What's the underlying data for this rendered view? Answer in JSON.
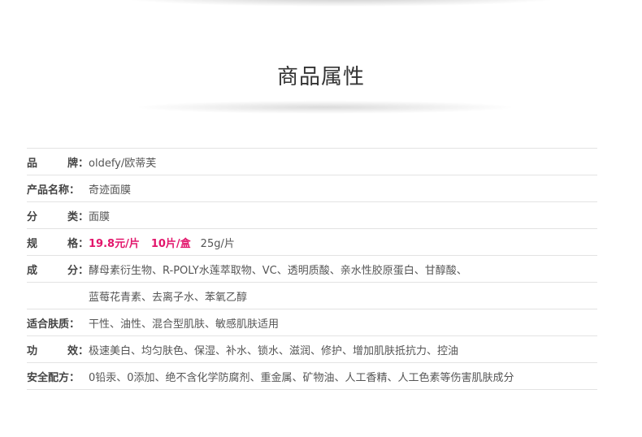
{
  "title": "商品属性",
  "rows": [
    {
      "label": "品　　牌：",
      "label_l": "品",
      "label_r": "牌：",
      "value": "oldefy/欧蒂芙"
    },
    {
      "label": "产品名称：",
      "value": "奇迹面膜"
    },
    {
      "label": "分　　类：",
      "label_l": "分",
      "label_r": "类：",
      "value": "面膜"
    },
    {
      "label": "规　　格：",
      "label_l": "规",
      "label_r": "格：",
      "price": "19.8元/片",
      "count": "10片/盒",
      "weight": "25g/片"
    },
    {
      "label": "成　　分：",
      "label_l": "成",
      "label_r": "分：",
      "value": "酵母素衍生物、R-POLY水莲萃取物、VC、透明质酸、亲水性胶原蛋白、甘醇酸、",
      "value2": "蓝莓花青素、去离子水、苯氧乙醇"
    },
    {
      "label": "适合肤质：",
      "value": "干性、油性、混合型肌肤、敏感肌肤适用"
    },
    {
      "label": "功　　效：",
      "label_l": "功",
      "label_r": "效：",
      "value": "极速美白、均匀肤色、保湿、补水、锁水、滋润、修护、增加肌肤抵抗力、控油"
    },
    {
      "label": "安全配方：",
      "value": "0铅汞、0添加、绝不含化学防腐剂、重金属、矿物油、人工香精、人工色素等伤害肌肤成分"
    }
  ],
  "colors": {
    "highlight": "#e2156b",
    "text": "#555555",
    "divider": "#e3e3e3"
  }
}
